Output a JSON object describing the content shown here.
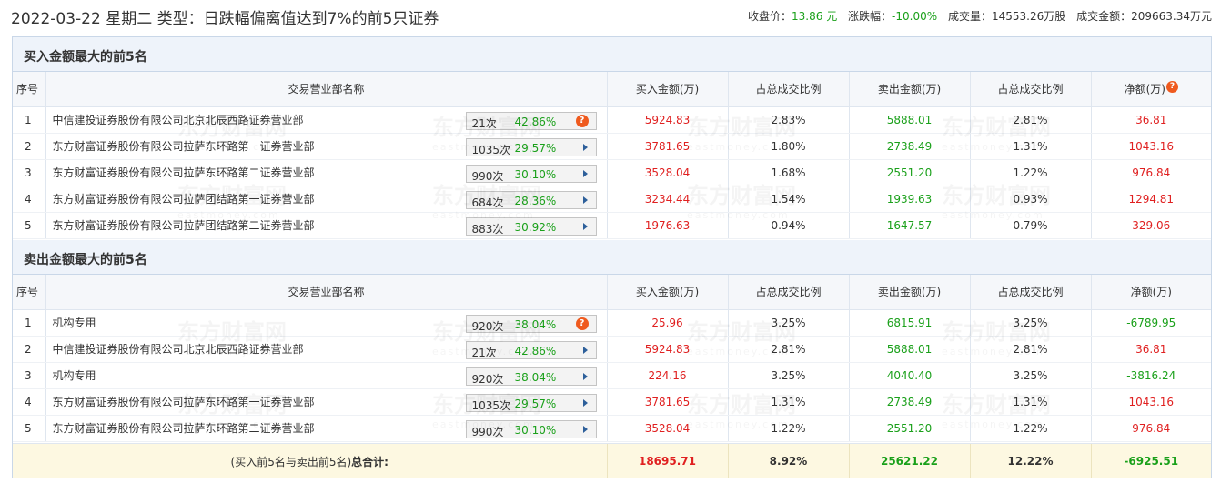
{
  "header": {
    "title": "2022-03-22 星期二 类型：日跌幅偏离值达到7%的前5只证券",
    "close_label": "收盘价：",
    "close_value": "13.86 元",
    "change_label": "涨跌幅：",
    "change_value": "-10.00%",
    "volume_label": "成交量：",
    "volume_value": "14553.26万股",
    "turnover_label": "成交金额：",
    "turnover_value": "209663.34万元"
  },
  "columns": {
    "seq": "序号",
    "name": "交易营业部名称",
    "buy": "买入金额(万)",
    "buy_ratio": "占总成交比例",
    "sell": "卖出金额(万)",
    "sell_ratio": "占总成交比例",
    "net": "净额(万)"
  },
  "buy_section": {
    "title": "买入金额最大的前5名",
    "rows": [
      {
        "seq": "1",
        "name": "中信建投证券股份有限公司北京北辰西路证券营业部",
        "count": "21次",
        "pct": "42.86%",
        "marker": "question-icon",
        "buy": "5924.83",
        "buy_ratio": "2.83%",
        "sell": "5888.01",
        "sell_ratio": "2.81%",
        "net": "36.81"
      },
      {
        "seq": "2",
        "name": "东方财富证券股份有限公司拉萨东环路第一证券营业部",
        "count": "1035次",
        "pct": "29.57%",
        "marker": "arrow-icon",
        "buy": "3781.65",
        "buy_ratio": "1.80%",
        "sell": "2738.49",
        "sell_ratio": "1.31%",
        "net": "1043.16"
      },
      {
        "seq": "3",
        "name": "东方财富证券股份有限公司拉萨东环路第二证券营业部",
        "count": "990次",
        "pct": "30.10%",
        "marker": "arrow-icon",
        "buy": "3528.04",
        "buy_ratio": "1.68%",
        "sell": "2551.20",
        "sell_ratio": "1.22%",
        "net": "976.84"
      },
      {
        "seq": "4",
        "name": "东方财富证券股份有限公司拉萨团结路第一证券营业部",
        "count": "684次",
        "pct": "28.36%",
        "marker": "arrow-icon",
        "buy": "3234.44",
        "buy_ratio": "1.54%",
        "sell": "1939.63",
        "sell_ratio": "0.93%",
        "net": "1294.81"
      },
      {
        "seq": "5",
        "name": "东方财富证券股份有限公司拉萨团结路第二证券营业部",
        "count": "883次",
        "pct": "30.92%",
        "marker": "arrow-icon",
        "buy": "1976.63",
        "buy_ratio": "0.94%",
        "sell": "1647.57",
        "sell_ratio": "0.79%",
        "net": "329.06"
      }
    ]
  },
  "sell_section": {
    "title": "卖出金额最大的前5名",
    "rows": [
      {
        "seq": "1",
        "name": "机构专用",
        "count": "920次",
        "pct": "38.04%",
        "marker": "question-icon",
        "buy": "25.96",
        "buy_ratio": "3.25%",
        "sell": "6815.91",
        "sell_ratio": "3.25%",
        "net": "-6789.95"
      },
      {
        "seq": "2",
        "name": "中信建投证券股份有限公司北京北辰西路证券营业部",
        "count": "21次",
        "pct": "42.86%",
        "marker": "arrow-icon",
        "buy": "5924.83",
        "buy_ratio": "2.81%",
        "sell": "5888.01",
        "sell_ratio": "2.81%",
        "net": "36.81"
      },
      {
        "seq": "3",
        "name": "机构专用",
        "count": "920次",
        "pct": "38.04%",
        "marker": "arrow-icon",
        "buy": "224.16",
        "buy_ratio": "3.25%",
        "sell": "4040.40",
        "sell_ratio": "3.25%",
        "net": "-3816.24"
      },
      {
        "seq": "4",
        "name": "东方财富证券股份有限公司拉萨东环路第一证券营业部",
        "count": "1035次",
        "pct": "29.57%",
        "marker": "arrow-icon",
        "buy": "3781.65",
        "buy_ratio": "1.31%",
        "sell": "2738.49",
        "sell_ratio": "1.31%",
        "net": "1043.16"
      },
      {
        "seq": "5",
        "name": "东方财富证券股份有限公司拉萨东环路第二证券营业部",
        "count": "990次",
        "pct": "30.10%",
        "marker": "arrow-icon",
        "buy": "3528.04",
        "buy_ratio": "1.22%",
        "sell": "2551.20",
        "sell_ratio": "1.22%",
        "net": "976.84"
      }
    ]
  },
  "total": {
    "label_prefix": "(买入前5名与卖出前5名)",
    "label_bold": "总合计:",
    "buy": "18695.71",
    "buy_ratio": "8.92%",
    "sell": "25621.22",
    "sell_ratio": "12.22%",
    "net": "-6925.51"
  },
  "watermark": {
    "cn": "东方财富网",
    "en": "eastmoney.com"
  },
  "colors": {
    "up": "#e02020",
    "down": "#1aa01a",
    "accent": "#ef5a1e",
    "header_bg": "#eef3fa",
    "total_bg": "#fdf8e1"
  }
}
